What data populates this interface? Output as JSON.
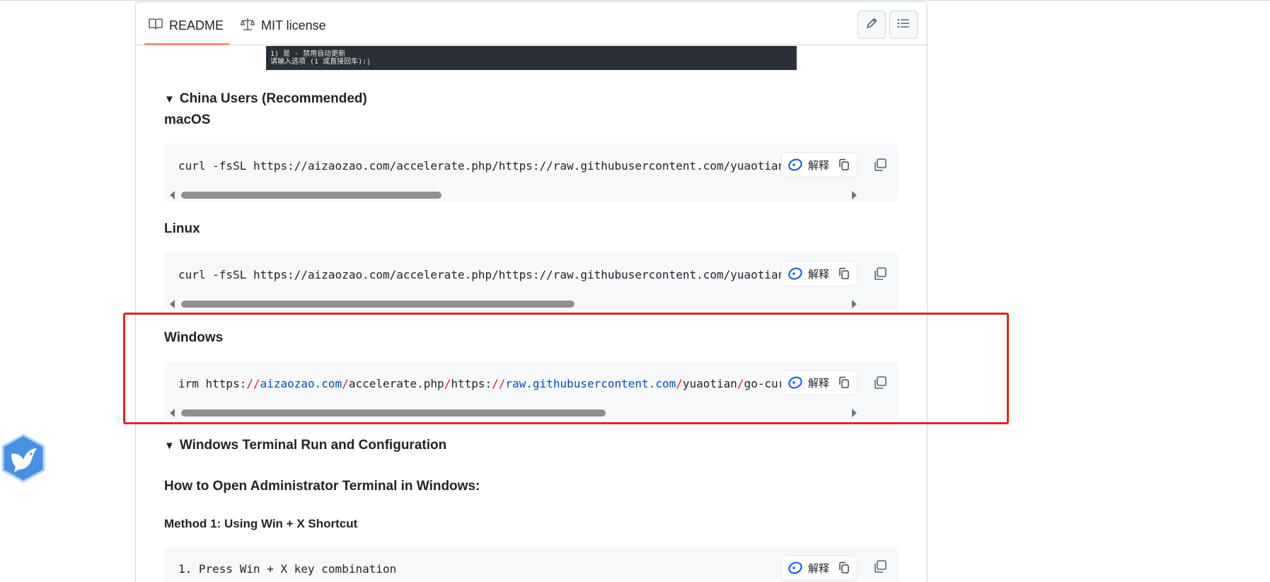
{
  "tabs": {
    "readme": "README",
    "license": "MIT license"
  },
  "terminal": {
    "line1": "1) 是 - 禁用自动更新",
    "line2": "请输入选项 (1 或直接回车):|"
  },
  "china_section": {
    "summary": "China Users (Recommended)",
    "macos_heading": "macOS",
    "macos_code": "curl -fsSL https://aizaozao.com/accelerate.php/https://raw.githubusercontent.com/yuaotian/g",
    "linux_heading": "Linux",
    "linux_code": "curl -fsSL https://aizaozao.com/accelerate.php/https://raw.githubusercontent.com/yuaotian/g",
    "windows_heading": "Windows",
    "windows_code": {
      "cmd": "irm https:",
      "sep1": "//",
      "host1": "aizaozao.com",
      "sep2": "/",
      "path1": "accelerate.php",
      "sep3": "/",
      "proto2": "https:",
      "sep4": "//",
      "host2": "raw.githubusercontent.com",
      "sep5": "/",
      "user": "yuaotian",
      "sep6": "/",
      "repo": "go-curso"
    }
  },
  "windows_terminal": {
    "summary": "Windows Terminal Run and Configuration",
    "heading": "How to Open Administrator Terminal in Windows:",
    "method1": "Method 1: Using Win + X Shortcut",
    "step1": "1. Press Win + X key combination"
  },
  "explain_label": "解释",
  "scroll_positions": {
    "macos": 0.31,
    "linux": 0.47,
    "windows": 0.51
  },
  "colors": {
    "highlight_border": "#e4231f",
    "tab_underline": "#fd8c73",
    "url_blue": "#0550ae",
    "separator_red": "#cf222e"
  },
  "icons": [
    "book-icon",
    "scale-icon",
    "pencil-icon",
    "list-icon",
    "ai-explain-icon",
    "copy-icon",
    "bird-icon"
  ]
}
